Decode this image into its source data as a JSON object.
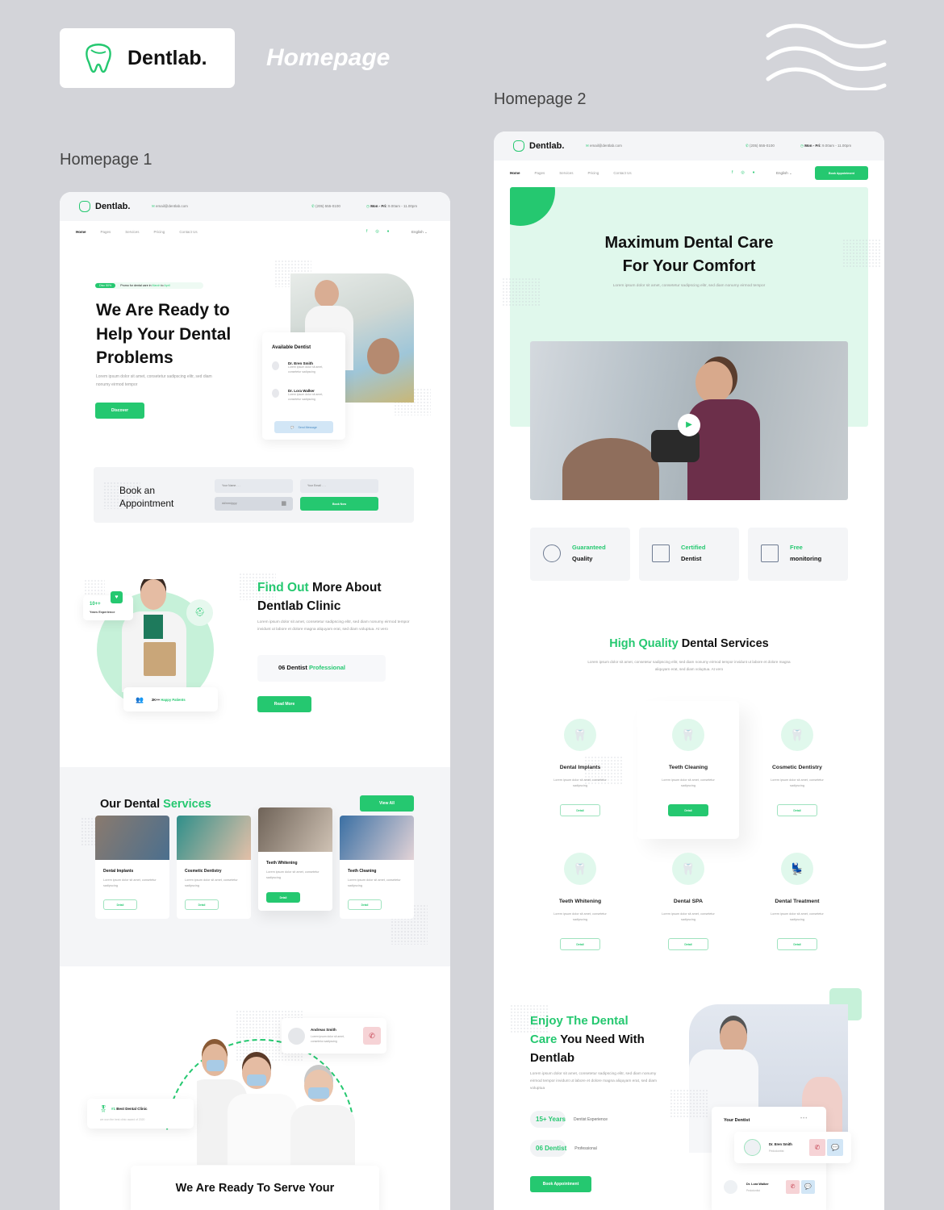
{
  "showcase": {
    "brand": "Dentlab.",
    "title": "Homepage",
    "label_1": "Homepage 1",
    "label_2": "Homepage 2"
  },
  "colors": {
    "accent": "#25c870",
    "accent_light": "#e0f8ec",
    "background": "#d3d4d9"
  },
  "header": {
    "brand": "Dentlab.",
    "email": "email@dentlab.com",
    "phone": "(205) 555-0100",
    "hours_days": "Mon - Fri:",
    "hours_time": "9.00am - 11.00pm",
    "nav": [
      "Home",
      "Pages",
      "Services",
      "Pricing",
      "Contact Us"
    ],
    "language": "English",
    "book_button": "Book Appointment",
    "social_icons": [
      "facebook-icon",
      "instagram-icon",
      "twitter-icon"
    ]
  },
  "home1": {
    "hero": {
      "promo_badge": "Disc 50%",
      "promo_text_a": "Promo for dental care in ",
      "promo_month_a": "March",
      "promo_to": " to ",
      "promo_month_b": "April",
      "title": "We Are Ready to Help Your Dental Problems",
      "text": "Lorem ipsum dolor sit amet, consetetur sadipscing elitr, sed diam nonumy eirmod tempor",
      "button": "Discover",
      "available_title": "Available Dentist",
      "dentists": [
        {
          "name": "Dr. Eren Smith",
          "text": "Lorem ipsum dolor sit amet, consetetur sadipscing"
        },
        {
          "name": "Dr. Lora Walker",
          "text": "Lorem ipsum dolor sit amet, consetetur sadipscing"
        }
      ],
      "send_message": "Send Message"
    },
    "booking": {
      "title": "Book an Appointment",
      "name_placeholder": "Your Name . . .",
      "email_placeholder": "Your Email . . .",
      "date_placeholder": "dd/mm/yyyy",
      "button": "Book Now"
    },
    "about": {
      "title_green": "Find Out",
      "title_rest": " More About Dentlab Clinic",
      "text": "Lorem ipsum dolor sit amet, consetetur sadipscing elitr, sed diam nonumy eirmod tempor invidunt ut labore et dolore magna aliquyam erat, sed diam voluptua. At vero",
      "stat_prefix": "06 Dentist ",
      "stat_green": "Professional",
      "button": "Read More",
      "experience_value": "10++",
      "experience_label": "Years Experience",
      "patients_value": "2K++ ",
      "patients_label": "Happy Patients"
    },
    "services": {
      "title": "Our Dental ",
      "title_green": "Services",
      "view_all": "View All",
      "items": [
        {
          "title": "Dental Implants",
          "text": "Lorem ipsum dolor sit amet, consetetur sadipscing",
          "button": "Detail"
        },
        {
          "title": "Cosmetic Dentistry",
          "text": "Lorem ipsum dolor sit amet, consetetur sadipscing",
          "button": "Detail"
        },
        {
          "title": "Teeth Whitening",
          "text": "Lorem ipsum dolor sit amet, consetetur sadipscing",
          "button": "Detail"
        },
        {
          "title": "Teeth Cleaning",
          "text": "Lorem ipsum dolor sit amet, consetetur sadipscing",
          "button": "Detail"
        }
      ]
    },
    "team": {
      "contact_name": "Andreas Smith",
      "contact_text": "Lorem ipsum dolor sit amet, consetetur sadipscing",
      "award_rank": "#1",
      "award_title": " Best Dental Clinic",
      "award_text": "we won the best clinic award of 2020",
      "title": "We Are Ready To Serve Your"
    }
  },
  "home2": {
    "hero": {
      "title_line1": "Maximum Dental Care",
      "title_line2": "For Your Comfort",
      "text": "Lorem ipsum dolor sit amet, consetetur sadipscing elitr, sed diam nonumy eirmod tempor"
    },
    "features": [
      {
        "green": "Guaranteed",
        "dark": "Quality",
        "icon": "thumbs-up-badge-icon"
      },
      {
        "green": "Certified",
        "dark": "Dentist",
        "icon": "certificate-icon"
      },
      {
        "green": "Free",
        "dark": "monitoring",
        "icon": "monitor-user-icon"
      }
    ],
    "services": {
      "title_green": "High Quality",
      "title_rest": " Dental Services",
      "text": "Lorem ipsum dolor sit amet, consetetur sadipscing elitr, sed diam nonumy eirmod tempor invidunt ut labore et dolore magna aliquyam erat, sed diam voluptua. At vero",
      "items": [
        {
          "title": "Dental Implants",
          "text": "Lorem ipsum dolor sit amet, consetetur sadipscing",
          "button": "Detail"
        },
        {
          "title": "Teeth Cleaning",
          "text": "Lorem ipsum dolor sit amet, consetetur sadipscing",
          "button": "Detail"
        },
        {
          "title": "Cosmetic Dentistry",
          "text": "Lorem ipsum dolor sit amet, consetetur sadipscing",
          "button": "Detail"
        },
        {
          "title": "Teeth Whitening",
          "text": "Lorem ipsum dolor sit amet, consetetur sadipscing",
          "button": "Detail"
        },
        {
          "title": "Dental SPA",
          "text": "Lorem ipsum dolor sit amet, consetetur sadipscing",
          "button": "Detail"
        },
        {
          "title": "Dental Treatment",
          "text": "Lorem ipsum dolor sit amet, consetetur sadipscing",
          "button": "Detail"
        }
      ]
    },
    "enjoy": {
      "title_green_1": "Enjoy The Dental",
      "title_green_2": "Care",
      "title_rest": " You Need With",
      "title_line3": "Dentlab",
      "text": "Lorem ipsum dolor sit amet, consetetur sadipscing elitr, sed diam nonumy eirmod tempor invidunt ut labore et dolore magna aliquyam erat, sed diam voluptua",
      "stat1_value": "15+ Years",
      "stat1_label": "Dentist Experience",
      "stat2_value": "06 Dentist",
      "stat2_label": "Professional",
      "button": "Book Appointment",
      "your_dentist": "Your Dentist",
      "dentists": [
        {
          "name": "Dr. Eren Smith",
          "role": "Pedodontist"
        },
        {
          "name": "Dr. Lora Walker",
          "role": "Pedodontist"
        }
      ]
    }
  }
}
